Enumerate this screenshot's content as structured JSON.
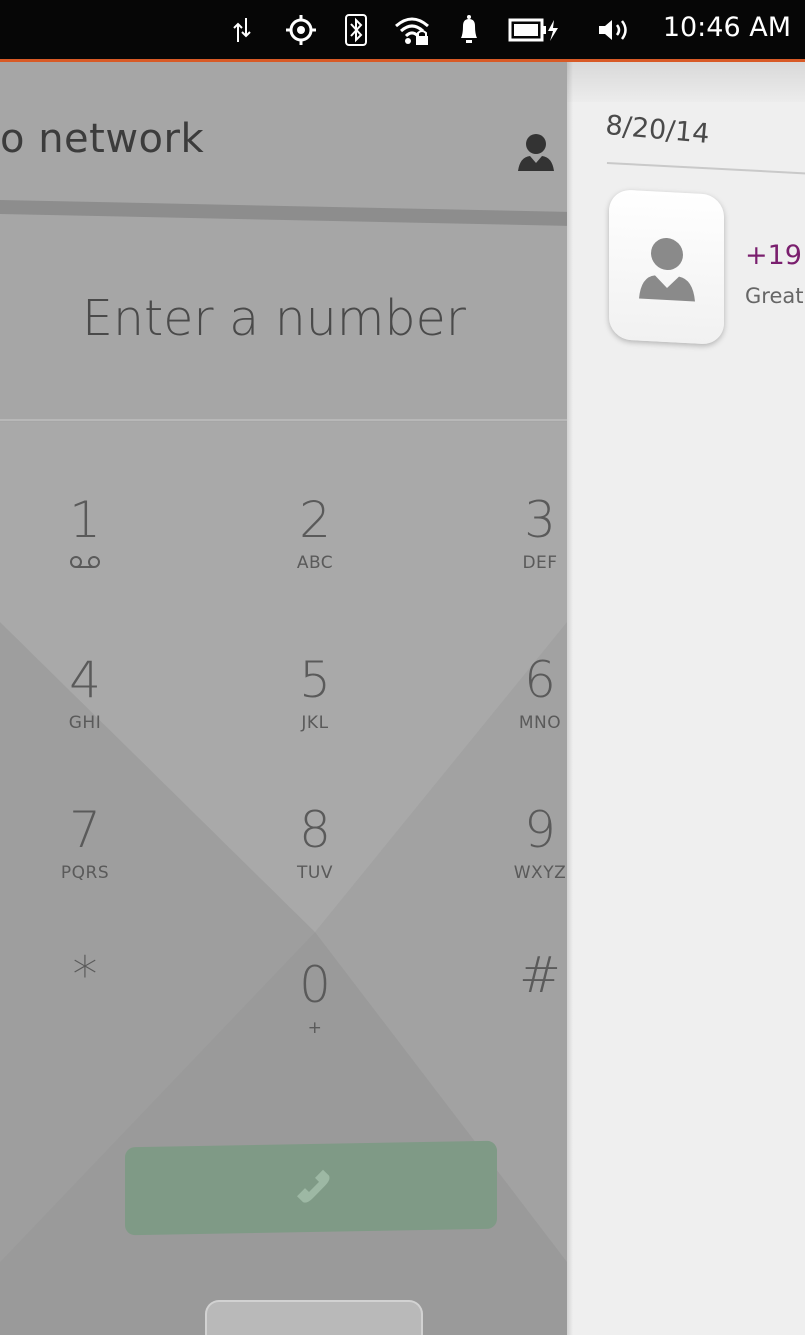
{
  "status_bar": {
    "time": "10:46 AM",
    "icons": [
      "data-transfer-icon",
      "location-icon",
      "bluetooth-icon",
      "wifi-secure-icon",
      "notification-bell-icon",
      "battery-charging-icon",
      "volume-icon"
    ],
    "accent_color": "#d85a26"
  },
  "dialer": {
    "header_title": "o network",
    "number_placeholder": "Enter a number",
    "keys": [
      {
        "digit": "1",
        "letters": ""
      },
      {
        "digit": "2",
        "letters": "ABC"
      },
      {
        "digit": "3",
        "letters": "DEF"
      },
      {
        "digit": "4",
        "letters": "GHI"
      },
      {
        "digit": "5",
        "letters": "JKL"
      },
      {
        "digit": "6",
        "letters": "MNO"
      },
      {
        "digit": "7",
        "letters": "PQRS"
      },
      {
        "digit": "8",
        "letters": "TUV"
      },
      {
        "digit": "9",
        "letters": "WXYZ"
      },
      {
        "digit": "*",
        "letters": ""
      },
      {
        "digit": "0",
        "letters": "+"
      },
      {
        "digit": "#",
        "letters": ""
      }
    ],
    "call_button_color": "#7f9a86"
  },
  "messages": {
    "date": "8/20/14",
    "thread": {
      "sender": "+19",
      "preview": "Great",
      "sender_color": "#7a1f6e"
    }
  }
}
